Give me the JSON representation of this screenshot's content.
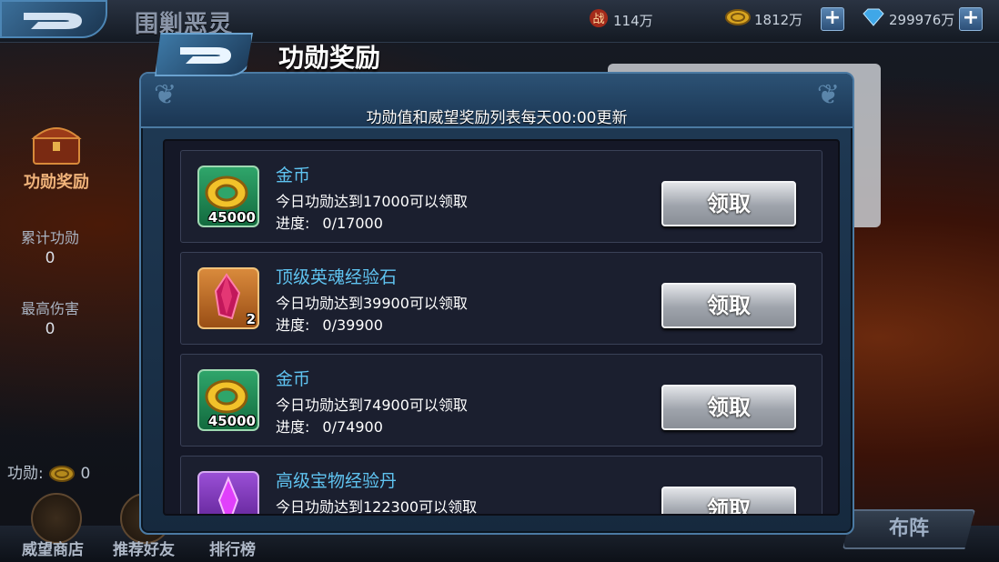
{
  "topbar": {
    "scene_title": "围剿恶灵",
    "power_value": "114万",
    "gold_value": "1812万",
    "gems_value": "299976万",
    "plus_label": "+"
  },
  "left_panel": {
    "tab_label": "功勋奖励",
    "cumulative_label": "累计功勋",
    "cumulative_value": "0",
    "highest_damage_label": "最高伤害",
    "highest_damage_value": "0",
    "merit_label": "功勋:",
    "merit_value": "0"
  },
  "bottom_nav": {
    "prestige_shop": "威望商店",
    "recommend_friends": "推荐好友",
    "ranking": "排行榜",
    "formation": "布阵"
  },
  "dialog": {
    "title": "功勋奖励",
    "notice": "功勋值和威望奖励列表每天00:00更新",
    "progress_label": "进度:",
    "claim_label": "领取",
    "rewards": [
      {
        "name": "金币",
        "requirement": "今日功勋达到17000可以领取",
        "progress": "0/17000",
        "quantity": "45000",
        "icon": "gold-coin-icon"
      },
      {
        "name": "顶级英魂经验石",
        "requirement": "今日功勋达到39900可以领取",
        "progress": "0/39900",
        "quantity": "2",
        "icon": "crystal-stone-icon"
      },
      {
        "name": "金币",
        "requirement": "今日功勋达到74900可以领取",
        "progress": "0/74900",
        "quantity": "45000",
        "icon": "gold-coin-icon"
      },
      {
        "name": "高级宝物经验丹",
        "requirement": "今日功勋达到122300可以领取",
        "progress": "",
        "quantity": "",
        "icon": "purple-pill-icon"
      }
    ]
  },
  "colors": {
    "item_name": "#5fc3f0",
    "dialog_border": "#4b7aa3",
    "claim_button": "#9ea3ab"
  }
}
